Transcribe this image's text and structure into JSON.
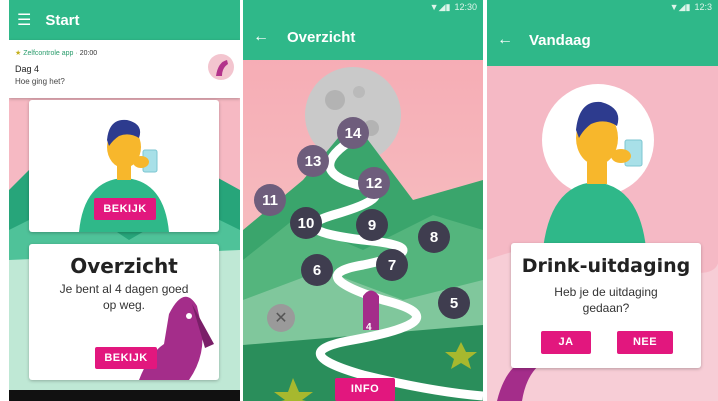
{
  "screen1": {
    "title": "Start",
    "notification": {
      "app_name": "Zelfcontrole app",
      "time": "20:00",
      "title": "Dag 4",
      "message": "Hoe ging het?"
    },
    "card1": {
      "button": "BEKIJK"
    },
    "card2": {
      "heading": "Overzicht",
      "text_line1": "Je bent al 4 dagen goed",
      "text_line2": "op weg.",
      "button": "BEKIJK"
    }
  },
  "screen2": {
    "time": "12:30",
    "title": "Overzicht",
    "nodes": [
      {
        "label": "14",
        "style": "light"
      },
      {
        "label": "13",
        "style": "light"
      },
      {
        "label": "12",
        "style": "light"
      },
      {
        "label": "11",
        "style": "light"
      },
      {
        "label": "10",
        "style": "dark"
      },
      {
        "label": "9",
        "style": "dark"
      },
      {
        "label": "8",
        "style": "dark"
      },
      {
        "label": "7",
        "style": "dark"
      },
      {
        "label": "6",
        "style": "dark"
      },
      {
        "label": "5",
        "style": "dark"
      }
    ],
    "dog_label": "4",
    "button": "INFO"
  },
  "screen3": {
    "time": "12:3",
    "title": "Vandaag",
    "dialog": {
      "heading": "Drink-uitdaging",
      "question_line1": "Heb je de uitdaging",
      "question_line2": "gedaan?",
      "yes": "JA",
      "no": "NEE"
    }
  },
  "colors": {
    "green": "#2fb889",
    "pink_button": "#e2177e",
    "dark_node": "#3f3d4f",
    "bg_pink": "#f4b8c2"
  }
}
